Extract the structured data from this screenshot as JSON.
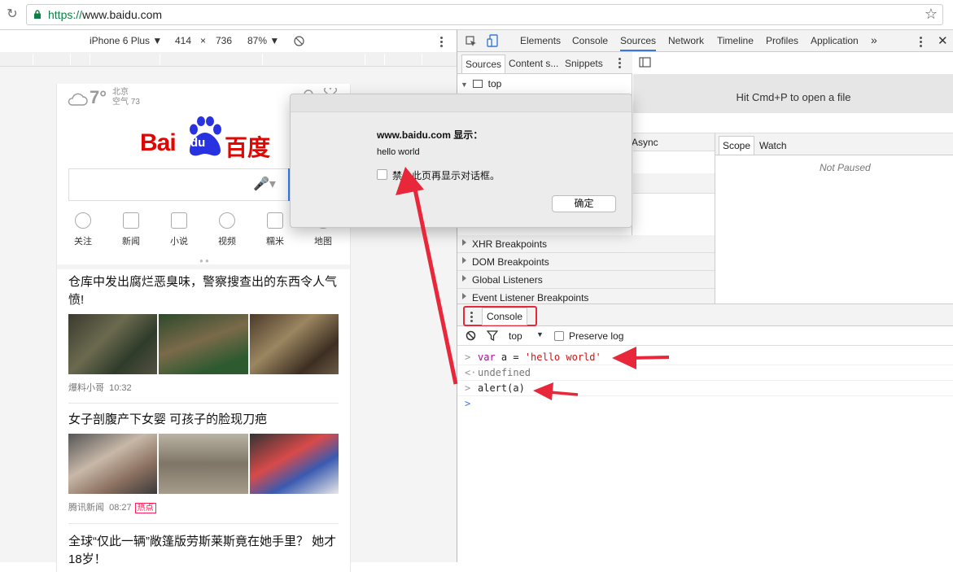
{
  "browser": {
    "url_scheme": "https://",
    "url_host": "www.baidu.com"
  },
  "emulation": {
    "device": "iPhone 6 Plus ▼",
    "width": "414",
    "times": "×",
    "height": "736",
    "zoom": "87% ▼"
  },
  "baidu": {
    "temperature": "7°",
    "city": "北京",
    "air": "空气 73",
    "logo_bai": "Bai",
    "logo_du": "du",
    "logo_cn": "百度",
    "shortcuts": [
      "关注",
      "新闻",
      "小说",
      "视频",
      "糯米",
      "地图"
    ],
    "news": [
      {
        "title": "仓库中发出腐烂恶臭味，警察搜查出的东西令人气愤!",
        "source": "爆料小哥",
        "time": "10:32"
      },
      {
        "title": "女子剖腹产下女婴 可孩子的脸现刀疤",
        "source": "腾讯新闻",
        "time": "08:27",
        "badge": "热点"
      },
      {
        "title": "全球“仅此一辆”敞篷版劳斯莱斯竟在她手里？ 她才18岁！"
      }
    ]
  },
  "dialog": {
    "title": "www.baidu.com 显示：",
    "message": "hello world",
    "checkbox_label": "禁止此页再显示对话框。",
    "ok_label": "确定"
  },
  "devtools": {
    "tabs": [
      "Elements",
      "Console",
      "Sources",
      "Network",
      "Timeline",
      "Profiles",
      "Application"
    ],
    "more": "»",
    "nav_tabs": [
      "Sources",
      "Content s...",
      "Snippets"
    ],
    "tree_top": "top",
    "open_file_hint": "Hit Cmd+P to open a file",
    "async_label": "Async",
    "scope_tabs": [
      "Scope",
      "Watch"
    ],
    "not_paused": "Not Paused",
    "breakpoints": [
      "XHR Breakpoints",
      "DOM Breakpoints",
      "Global Listeners",
      "Event Listener Breakpoints"
    ],
    "console_tab": "Console",
    "context": "top",
    "preserve_log": "Preserve log",
    "lines": [
      {
        "prompt": ">",
        "kw": "var",
        "rest": " a = ",
        "str": "'hello world'"
      },
      {
        "prompt": "<·",
        "text": "undefined"
      },
      {
        "prompt": ">",
        "text": "alert(a)"
      },
      {
        "prompt": ">",
        "text": ""
      }
    ]
  },
  "colors": {
    "accent": "#3879d9",
    "baidu_red": "#e10602",
    "baidu_blue": "#2932e1",
    "annotation_red": "#e8283a"
  }
}
